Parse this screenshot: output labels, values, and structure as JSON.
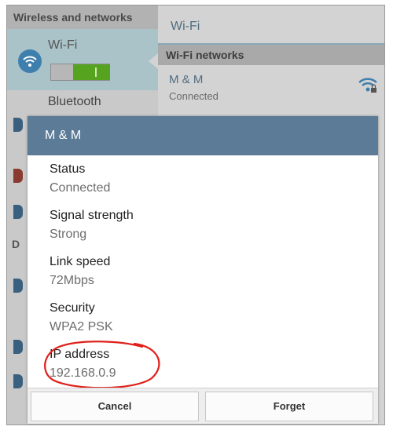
{
  "background": {
    "section_header": "Wireless and networks",
    "wifi_label": "Wi-Fi",
    "bluetooth_label": "Bluetooth",
    "side_letter": "D",
    "panel_title": "Wi-Fi",
    "networks_header": "Wi-Fi networks",
    "network_name": "M & M",
    "network_status": "Connected",
    "wifi_toggle_on": true
  },
  "dialog": {
    "title": "M & M",
    "fields": [
      {
        "label": "Status",
        "value": "Connected"
      },
      {
        "label": "Signal strength",
        "value": "Strong"
      },
      {
        "label": "Link speed",
        "value": "72Mbps"
      },
      {
        "label": "Security",
        "value": "WPA2 PSK"
      },
      {
        "label": "IP address",
        "value": "192.168.0.9"
      }
    ],
    "buttons": {
      "cancel": "Cancel",
      "forget": "Forget"
    }
  },
  "colors": {
    "dialog_header": "#5b7b96",
    "toggle_on": "#55a31e",
    "annotation": "#e0201a"
  },
  "icons": [
    "wifi-icon",
    "wifi-lock-icon"
  ]
}
